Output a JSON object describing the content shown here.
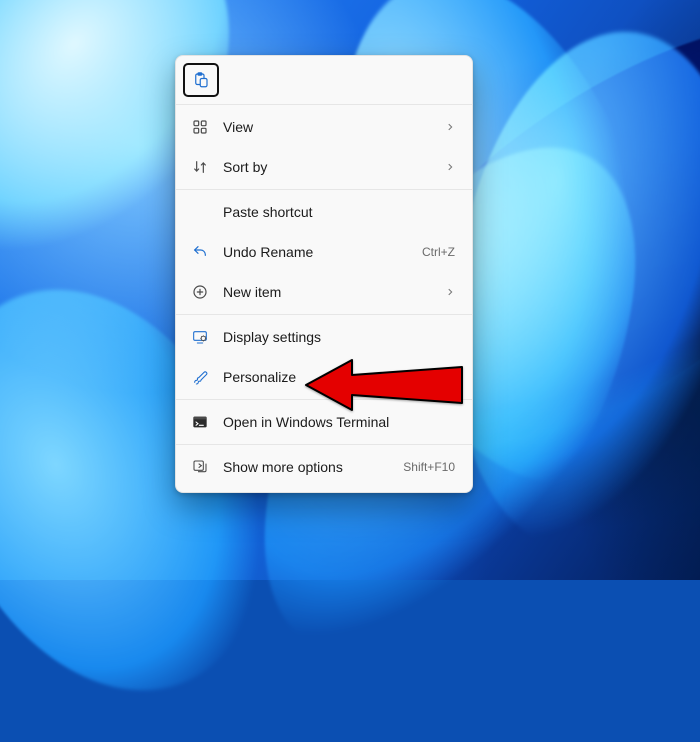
{
  "menu": {
    "top_bar": {
      "paste_tooltip": "Paste"
    },
    "items": {
      "view": {
        "label": "View",
        "has_submenu": true
      },
      "sort_by": {
        "label": "Sort by",
        "has_submenu": true
      },
      "paste_shortcut": {
        "label": "Paste shortcut"
      },
      "undo_rename": {
        "label": "Undo Rename",
        "accelerator": "Ctrl+Z"
      },
      "new_item": {
        "label": "New item",
        "has_submenu": true
      },
      "display_settings": {
        "label": "Display settings"
      },
      "personalize": {
        "label": "Personalize"
      },
      "open_terminal": {
        "label": "Open in Windows Terminal"
      },
      "show_more_options": {
        "label": "Show more options",
        "accelerator": "Shift+F10"
      }
    }
  },
  "colors": {
    "icon_blue": "#1f6fd0",
    "icon_gray": "#4a4a4a",
    "arrow_red": "#e40000",
    "arrow_stroke": "#000000"
  }
}
